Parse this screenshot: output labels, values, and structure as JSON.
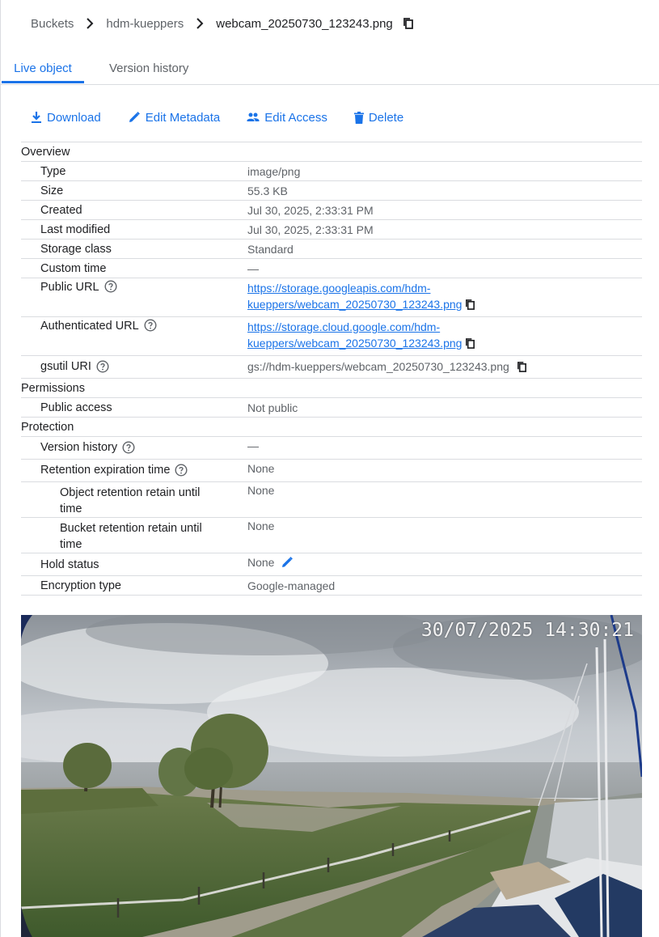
{
  "breadcrumb": {
    "root": "Buckets",
    "bucket": "hdm-kueppers",
    "object": "webcam_20250730_123243.png"
  },
  "tabs": [
    {
      "label": "Live object",
      "active": true
    },
    {
      "label": "Version history",
      "active": false
    }
  ],
  "toolbar": {
    "download": "Download",
    "edit_metadata": "Edit Metadata",
    "edit_access": "Edit Access",
    "delete": "Delete"
  },
  "overview": {
    "section": "Overview",
    "type": {
      "label": "Type",
      "value": "image/png"
    },
    "size": {
      "label": "Size",
      "value": "55.3 KB"
    },
    "created": {
      "label": "Created",
      "value": "Jul 30, 2025, 2:33:31 PM"
    },
    "last_modified": {
      "label": "Last modified",
      "value": "Jul 30, 2025, 2:33:31 PM"
    },
    "storage_class": {
      "label": "Storage class",
      "value": "Standard"
    },
    "custom_time": {
      "label": "Custom time",
      "value": "—"
    },
    "public_url": {
      "label": "Public URL",
      "line1": "https://storage.googleapis.com/hdm-",
      "line2": "kueppers/webcam_20250730_123243.png"
    },
    "authenticated_url": {
      "label": "Authenticated URL",
      "line1": "https://storage.cloud.google.com/hdm-",
      "line2": "kueppers/webcam_20250730_123243.png"
    },
    "gsutil_uri": {
      "label": "gsutil URI",
      "value": "gs://hdm-kueppers/webcam_20250730_123243.png"
    }
  },
  "permissions": {
    "section": "Permissions",
    "public_access": {
      "label": "Public access",
      "value": "Not public"
    }
  },
  "protection": {
    "section": "Protection",
    "version_history": {
      "label": "Version history",
      "value": "—"
    },
    "retention_expiration": {
      "label": "Retention expiration time",
      "value": "None"
    },
    "object_retention": {
      "label1": "Object retention retain until",
      "label2": "time",
      "value": "None"
    },
    "bucket_retention": {
      "label1": "Bucket retention retain until",
      "label2": "time",
      "value": "None"
    },
    "hold_status": {
      "label": "Hold status",
      "value": "None"
    },
    "encryption_type": {
      "label": "Encryption type",
      "value": "Google-managed"
    }
  },
  "preview": {
    "timestamp": "30/07/2025 14:30:21"
  },
  "colors": {
    "accent": "#1a73e8",
    "text": "#202124",
    "secondary": "#5f6368",
    "divider": "#dadce0"
  },
  "icons": {
    "separator": "chevron-right-icon",
    "copy": "copy-icon",
    "download": "download-icon",
    "edit": "pencil-icon",
    "access": "people-icon",
    "delete": "trash-icon",
    "help": "help-circle-icon"
  }
}
